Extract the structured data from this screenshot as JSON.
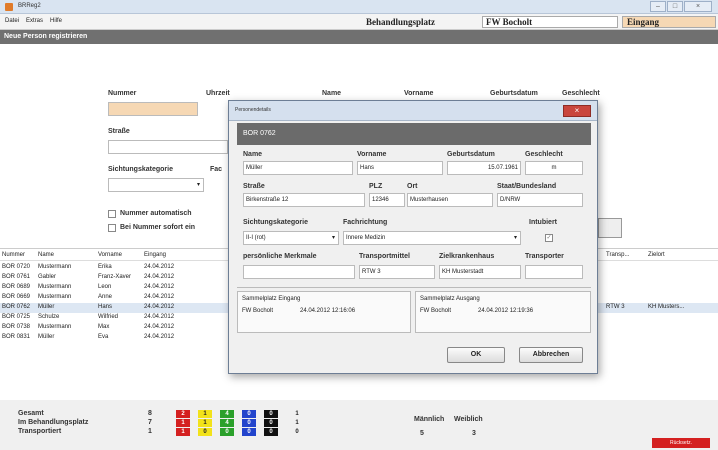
{
  "window": {
    "title": "BRReg2",
    "controls": [
      "–",
      "□",
      "×"
    ]
  },
  "menu": [
    "Datei",
    "Extras",
    "Hilfe"
  ],
  "location": {
    "label": "Behandlungsplatz",
    "value": "FW Bocholt",
    "mode": "Eingang"
  },
  "section_title": "Neue Person registrieren",
  "form": {
    "labels": {
      "nummer": "Nummer",
      "uhrzeit": "Uhrzeit",
      "name": "Name",
      "vorname": "Vorname",
      "geburtsdatum": "Geburtsdatum",
      "geschlecht": "Geschlecht",
      "strasse": "Straße",
      "sichtung": "Sichtungskategorie",
      "fach": "Fac"
    },
    "checkboxes": [
      "Nummer automatisch",
      "Bei Nummer sofort ein"
    ]
  },
  "grid": {
    "headers": [
      "Nummer",
      "Name",
      "Vorname",
      "Eingang",
      "Transp...",
      "Zielort"
    ],
    "rows": [
      [
        "BOR 0720",
        "Mustermann",
        "Erika",
        "24.04.2012"
      ],
      [
        "BOR 0761",
        "Gabler",
        "Franz-Xaver",
        "24.04.2012"
      ],
      [
        "BOR 0689",
        "Mustermann",
        "Leon",
        "24.04.2012"
      ],
      [
        "BOR 0669",
        "Mustermann",
        "Anne",
        "24.04.2012"
      ],
      [
        "BOR 0762",
        "Müller",
        "Hans",
        "24.04.2012"
      ],
      [
        "BOR 0725",
        "Schulze",
        "Wilfried",
        "24.04.2012"
      ],
      [
        "BOR 0738",
        "Mustermann",
        "Max",
        "24.04.2012"
      ],
      [
        "BOR 0831",
        "Müller",
        "Eva",
        "24.04.2012"
      ]
    ],
    "selected_extra": {
      "transport": "RTW 3",
      "ziel": "KH Musters..."
    }
  },
  "summary": {
    "rows": [
      {
        "label": "Gesamt",
        "total": "8",
        "counts": [
          "2",
          "1",
          "4",
          "0",
          "0",
          "1"
        ]
      },
      {
        "label": "Im Behandlungsplatz",
        "total": "7",
        "counts": [
          "1",
          "1",
          "4",
          "0",
          "0",
          "1"
        ]
      },
      {
        "label": "Transportiert",
        "total": "1",
        "counts": [
          "1",
          "0",
          "0",
          "0",
          "0",
          "0"
        ]
      }
    ],
    "colors": [
      "#d42020",
      "#f2e21a",
      "#2aa02a",
      "#2244cc",
      "#111111",
      "#f2e21a"
    ],
    "gender": {
      "male_label": "Männlich",
      "female_label": "Weiblich",
      "male": "5",
      "female": "3"
    },
    "status_button": "Rücksetz."
  },
  "dialog": {
    "title": "Personendetails",
    "close": "×",
    "head": "BOR 0762",
    "labels": {
      "name": "Name",
      "vorname": "Vorname",
      "geburtsdatum": "Geburtsdatum",
      "geschlecht": "Geschlecht",
      "strasse": "Straße",
      "plz": "PLZ",
      "ort": "Ort",
      "staat": "Staat/Bundesland",
      "sichtung": "Sichtungskategorie",
      "fach": "Fachrichtung",
      "intubiert": "Intubiert",
      "merkmale": "persönliche Merkmale",
      "transportmittel": "Transportmittel",
      "zielkrankenhaus": "Zielkrankenhaus",
      "transporteur": "Transporter"
    },
    "values": {
      "name": "Müller",
      "vorname": "Hans",
      "geburtsdatum": "15.07.1961",
      "geschlecht": "m",
      "strasse": "Birkenstraße 12",
      "plz": "12346",
      "ort": "Musterhausen",
      "staat": "D/NRW",
      "sichtung": "II-I (rot)",
      "fach": "Innere Medizin",
      "merkmale": "",
      "transportmittel": "RTW 3",
      "zielkrankenhaus": "KH Musterstadt",
      "transporteur": ""
    },
    "eingang": {
      "label": "Sammelplatz Eingang",
      "place": "FW Bocholt",
      "time": "24.04.2012 12:16:06"
    },
    "ausgang": {
      "label": "Sammelplatz Ausgang",
      "place": "FW Bocholt",
      "time": "24.04.2012 12:19:36"
    },
    "ok": "OK",
    "cancel": "Abbrechen"
  }
}
